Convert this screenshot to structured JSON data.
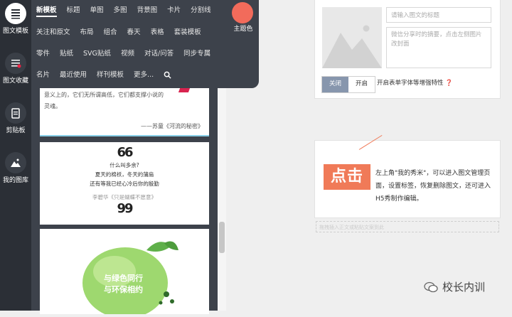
{
  "rail": {
    "items": [
      {
        "label": "图文模板",
        "icon": "lines-icon"
      },
      {
        "label": "图文收藏",
        "icon": "list-icon"
      },
      {
        "label": "剪贴板",
        "icon": "clipboard-icon"
      },
      {
        "label": "我的图库",
        "icon": "mountain-icon"
      }
    ]
  },
  "menu": {
    "row1": [
      "新模板",
      "标题",
      "单图",
      "多图",
      "背景图",
      "卡片",
      "分割线"
    ],
    "row2": [
      "关注和原文",
      "布局",
      "组合",
      "春天",
      "表格",
      "套装模板"
    ],
    "row3": [
      "零件",
      "贴纸",
      "SVG贴纸",
      "视频",
      "对话/问答",
      "同步专属"
    ],
    "row4": [
      "名片",
      "最近使用",
      "样刊模板",
      "更多..."
    ],
    "theme_label": "主题色",
    "theme_color": "#f26b5b"
  },
  "cards": {
    "card1_text1": "意义上的，它们无所谓高低，它们都支撑小说的",
    "card1_text2": "灵魂。",
    "card1_author": "——苏童《河流的秘密》",
    "card2_open": "66",
    "card2_lines": [
      "什么叫多余?",
      "夏天的棉袄，冬天的蒲扇",
      "还有等我已经心冷后你的殷勤"
    ],
    "card2_author": "李碧华《只是蝴蝶不愿意》",
    "card2_close": "99",
    "card3_text": "与绿色同行\n与环保相约"
  },
  "editor": {
    "title_placeholder": "请输入图文的标题",
    "summary_placeholder": "微信分享时的摘要，点击左侧图片改封面",
    "btn_off": "关闭",
    "btn_on": "开启",
    "toggle_label": "开启表单字体等增强特性 ❓"
  },
  "tip": {
    "tap": "点击",
    "text": "左上角\"我的秀米\"，可以进入图文管理页面，设置标签，恢复删除图文，还可进入H5秀制作编辑。",
    "dash": "拖拽插入正文或粘贴文案到此"
  },
  "watermark": {
    "text": "校长内训",
    "icon": "wechat-icon"
  }
}
